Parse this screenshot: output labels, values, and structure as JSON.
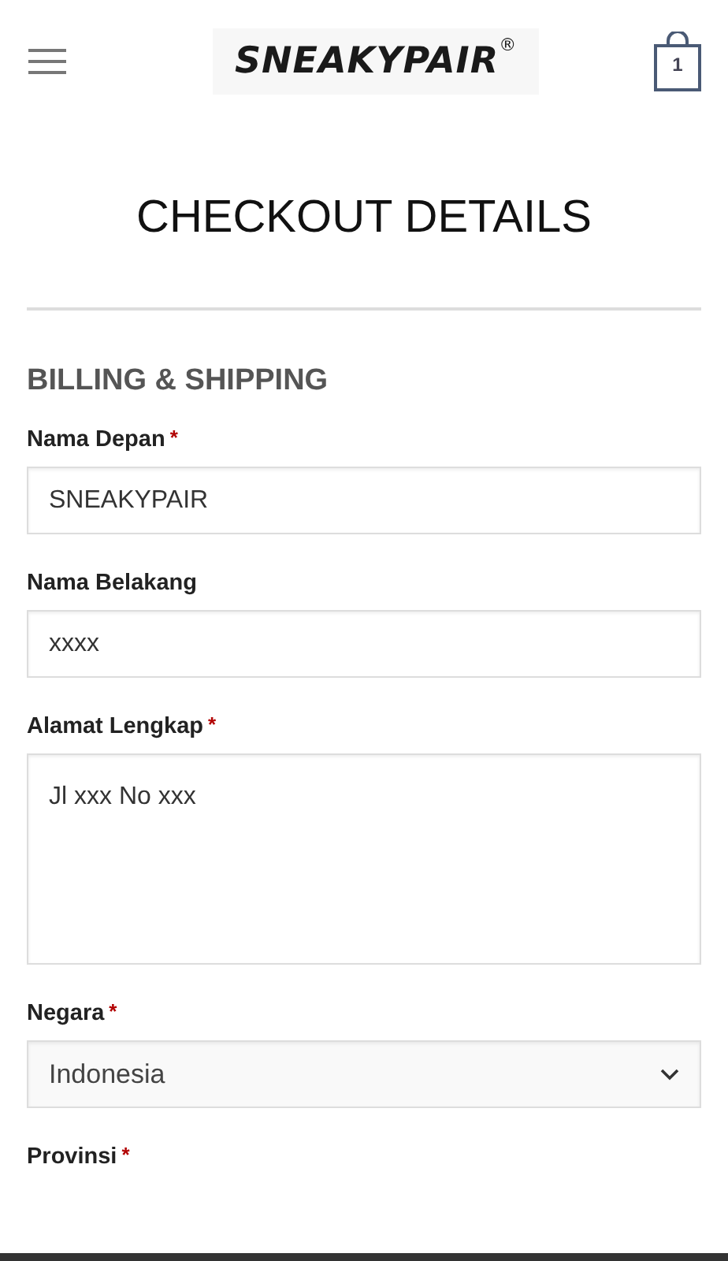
{
  "header": {
    "logo": "SNEAKYPAIR$^{®}$",
    "cart_count": "1"
  },
  "page_title": "CHECKOUT DETAILS",
  "section_title": "BILLING & SHIPPING",
  "fields": [
    {
      "kind": "text",
      "label": "Nama Depan",
      "required_mark": "*",
      "value": "SNEAKYPAIR"
    },
    {
      "kind": "text",
      "label": "Nama Belakang",
      "value": "xxxx"
    },
    {
      "kind": "textarea",
      "label": "Alamat Lengkap",
      "required_mark": "*",
      "value": "Jl xxx No xxx"
    },
    {
      "kind": "select",
      "label": "Negara",
      "required_mark": "*",
      "value": "Indonesia"
    },
    {
      "kind": "label_only",
      "label": "Provinsi",
      "required_mark": "*"
    }
  ]
}
